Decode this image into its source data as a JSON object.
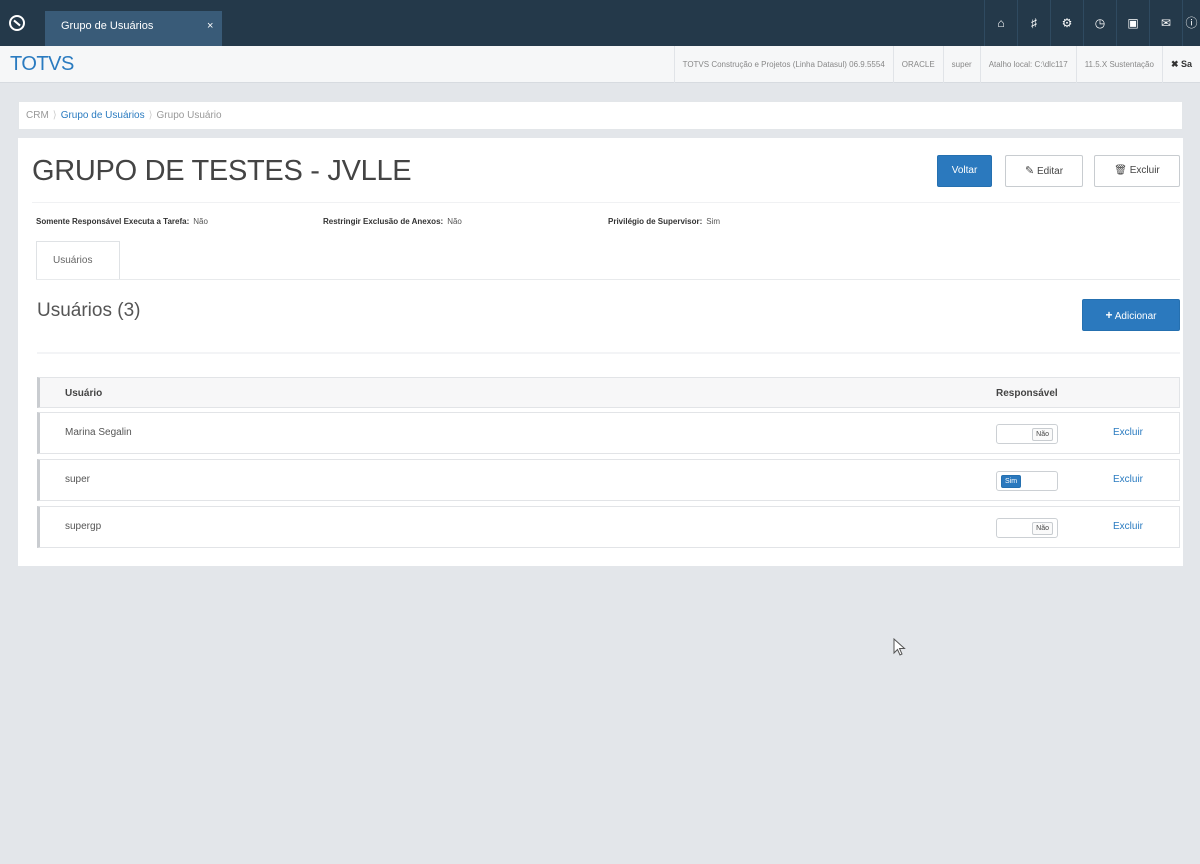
{
  "topbar": {
    "tab_label": "Grupo de Usuários",
    "tab_close": "×",
    "icons": [
      "home-icon",
      "sitemap-icon",
      "gear-icon",
      "clock-icon",
      "document-icon",
      "mail-icon",
      "info-icon"
    ]
  },
  "brandbar": {
    "brand": "TOTVS",
    "items": [
      "TOTVS Construção e Projetos (Linha Datasul) 06.9.5554",
      "ORACLE",
      "super",
      "Atalho local: C:\\dlc117",
      "11.5.X Sustentação"
    ],
    "exit_label": "✖ Sa"
  },
  "breadcrumb": {
    "root": "CRM",
    "middle": "Grupo de Usuários",
    "current": "Grupo Usuário"
  },
  "page": {
    "title": "GRUPO DE TESTES - JVLLE",
    "back_label": "Voltar",
    "edit_label": "Editar",
    "delete_label": "Excluir"
  },
  "props": {
    "p1_label": "Somente Responsável Executa a Tarefa:",
    "p1_value": "Não",
    "p2_label": "Restringir Exclusão de Anexos:",
    "p2_value": "Não",
    "p3_label": "Privilégio de Supervisor:",
    "p3_value": "Sim"
  },
  "tabs": {
    "users": "Usuários"
  },
  "users_section": {
    "title": "Usuários (3)",
    "add_label": "Adicionar",
    "col_user": "Usuário",
    "col_resp": "Responsável",
    "rows": [
      {
        "name": "Marina Segalin",
        "toggle": "Não",
        "toggle_on": false,
        "action": "Excluir"
      },
      {
        "name": "super",
        "toggle": "Sim",
        "toggle_on": true,
        "action": "Excluir"
      },
      {
        "name": "supergp",
        "toggle": "Não",
        "toggle_on": false,
        "action": "Excluir"
      }
    ]
  }
}
